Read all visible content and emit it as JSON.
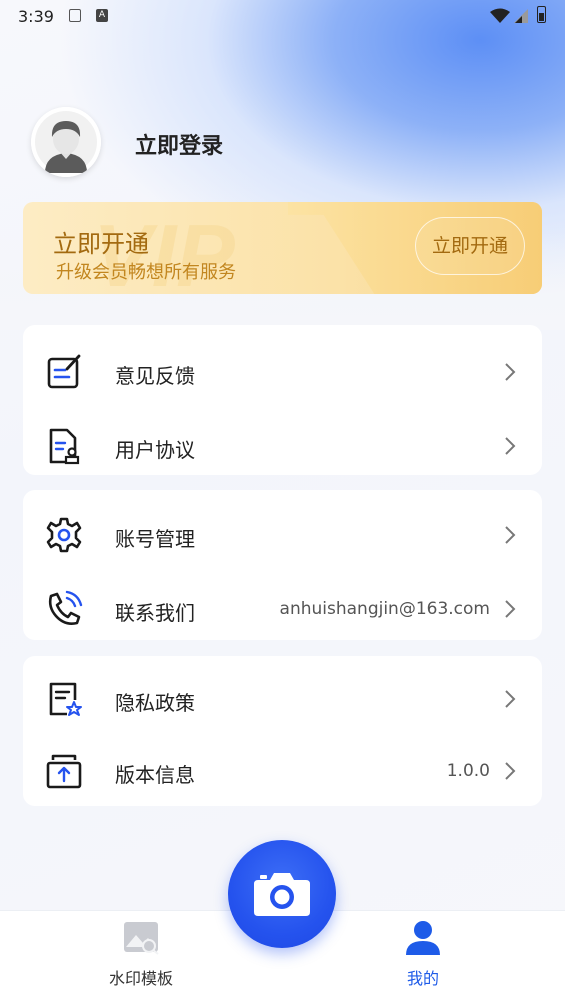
{
  "status_bar": {
    "time": "3:39",
    "a_icon": "A"
  },
  "profile": {
    "login_label": "立即登录"
  },
  "vip_banner": {
    "title": "立即开通",
    "subtitle": "升级会员畅想所有服务",
    "button": "立即开通"
  },
  "menu_groups": [
    {
      "items": [
        {
          "label": "意见反馈",
          "icon": "feedback-edit-icon",
          "value": ""
        },
        {
          "label": "用户协议",
          "icon": "user-agreement-icon",
          "value": ""
        }
      ]
    },
    {
      "items": [
        {
          "label": "账号管理",
          "icon": "gear-icon",
          "value": ""
        },
        {
          "label": "联系我们",
          "icon": "phone-icon",
          "value": "anhuishangjin@163.com"
        }
      ]
    },
    {
      "items": [
        {
          "label": "隐私政策",
          "icon": "privacy-doc-star-icon",
          "value": ""
        },
        {
          "label": "版本信息",
          "icon": "version-upload-icon",
          "value": "1.0.0"
        }
      ]
    }
  ],
  "bottom_nav": {
    "items": [
      {
        "label": "水印模板",
        "icon": "watermark-template-icon",
        "active": false
      },
      {
        "label": "我的",
        "icon": "user-icon",
        "active": true
      }
    ],
    "center_button_icon": "camera-icon"
  },
  "colors": {
    "accent": "#2553ee",
    "vip_text": "#a36a10",
    "nav_active": "#1e5be8",
    "nav_inactive": "#333333"
  }
}
